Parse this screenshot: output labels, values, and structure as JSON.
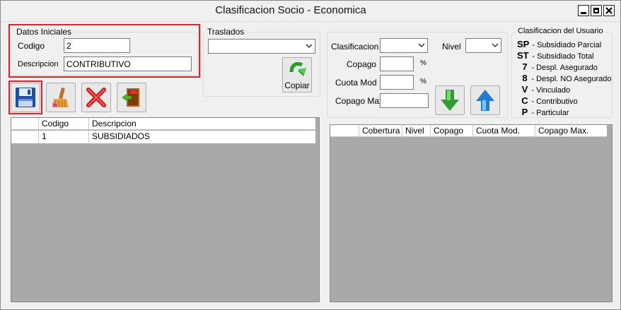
{
  "window": {
    "title": "Clasificacion Socio - Economica"
  },
  "datos": {
    "group_title": "Datos Iniciales",
    "codigo_label": "Codigo",
    "codigo_value": "2",
    "descripcion_label": "Descripcion",
    "descripcion_value": "CONTRIBUTIVO"
  },
  "traslados": {
    "group_title": "Traslados",
    "copiar_label": "Copiar"
  },
  "clasif_form": {
    "clasificacion_label": "Clasificacion",
    "nivel_label": "Nivel",
    "copago_label": "Copago",
    "copago_unit": "%",
    "cuota_label": "Cuota Mod",
    "cuota_unit": "%",
    "copago_max_label": "Copago Max"
  },
  "usuario": {
    "group_title": "Clasificacion del Usuario",
    "items": [
      {
        "code": "SP",
        "desc": "- Subsidiado Parcial"
      },
      {
        "code": "ST",
        "desc": "- Subsidiado Total"
      },
      {
        "code": "7",
        "desc": "- Despl. Asegurado"
      },
      {
        "code": "8",
        "desc": "- Despl. NO Asegurado"
      },
      {
        "code": "V",
        "desc": "- Vinculado"
      },
      {
        "code": "C",
        "desc": "- Contributivo"
      },
      {
        "code": "P",
        "desc": "- Particular"
      }
    ]
  },
  "left_grid": {
    "columns": [
      "",
      "Codigo",
      "Descripcion"
    ],
    "rows": [
      {
        "codigo": "1",
        "descripcion": "SUBSIDIADOS"
      }
    ]
  },
  "right_grid": {
    "columns": [
      "",
      "Cobertura",
      "Nivel",
      "Copago",
      "Cuota Mod.",
      "Copago Max."
    ]
  },
  "icons": {
    "save": "floppy-disk-icon",
    "clean": "broom-icon",
    "delete": "red-x-icon",
    "exit": "exit-door-icon",
    "copy": "green-curved-arrow-icon",
    "down": "green-down-arrow-icon",
    "up": "blue-up-arrow-icon"
  },
  "colors": {
    "highlight": "#e0202a",
    "grid_bg": "#a9a9a9"
  }
}
